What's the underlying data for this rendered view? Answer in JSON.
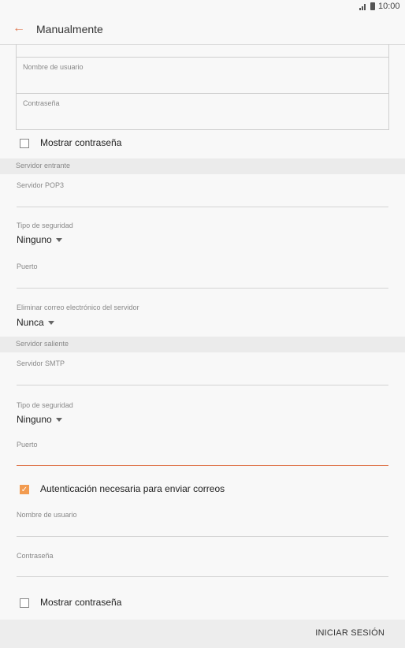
{
  "status_bar": {
    "time": "10:00",
    "signal_icon": "signal-icon",
    "battery_icon": "battery-icon"
  },
  "app_bar": {
    "title": "Manualmente",
    "back_icon": "arrow-left-icon",
    "accent": "#e07b53"
  },
  "account_box": {
    "username_label": "Nombre de usuario",
    "username_value": "",
    "password_label": "Contraseña",
    "password_value": ""
  },
  "show_password_1": {
    "label": "Mostrar contraseña",
    "checked": false
  },
  "incoming": {
    "header": "Servidor entrante",
    "server_label": "Servidor POP3",
    "server_value": "",
    "security_label": "Tipo de seguridad",
    "security_value": "Ninguno",
    "port_label": "Puerto",
    "port_value": "",
    "delete_label": "Eliminar correo electrónico del servidor",
    "delete_value": "Nunca"
  },
  "outgoing": {
    "header": "Servidor saliente",
    "server_label": "Servidor SMTP",
    "server_value": "",
    "security_label": "Tipo de seguridad",
    "security_value": "Ninguno",
    "port_label": "Puerto",
    "port_value": "",
    "auth_label": "Autenticación necesaria para enviar correos",
    "auth_checked": true,
    "username_label": "Nombre de usuario",
    "username_value": "",
    "password_label": "Contraseña",
    "password_value": ""
  },
  "show_password_2": {
    "label": "Mostrar contraseña",
    "checked": false
  },
  "bottom": {
    "signin_label": "INICIAR SESIÓN"
  },
  "colors": {
    "accent": "#e07b53",
    "checkbox_checked": "#f29b50",
    "section_bg": "#ebebeb"
  }
}
